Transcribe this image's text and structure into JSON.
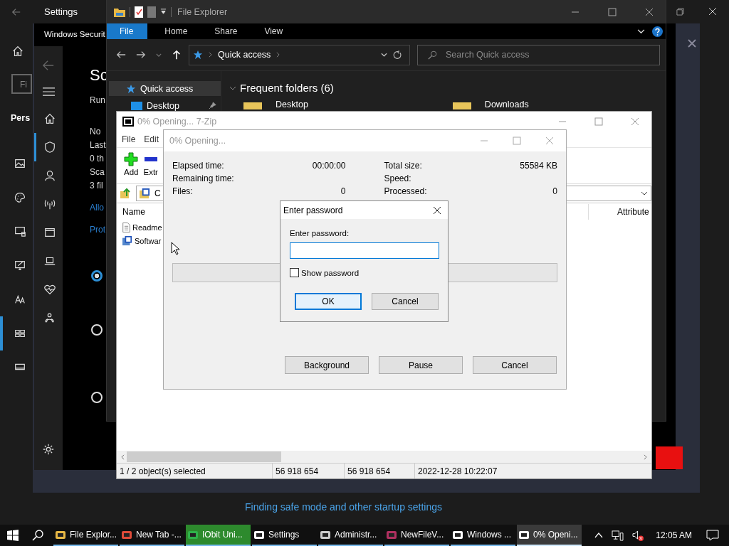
{
  "settings": {
    "title": "Settings",
    "search_placeholder": "Fi",
    "heading": "Pers",
    "nav": [
      {
        "selected": false
      },
      {
        "selected": false
      },
      {
        "selected": false
      },
      {
        "selected": false
      },
      {
        "selected": false
      },
      {
        "selected": true
      },
      {
        "selected": false
      }
    ],
    "link": "Finding safe mode and other startup settings"
  },
  "security": {
    "title": "Windows Securit",
    "heading": "Sc",
    "subtitle": "Run",
    "lines": [
      "No",
      "Last",
      "0 th",
      "Sca",
      "3 fil"
    ],
    "links": [
      "Allo",
      "Prot"
    ],
    "nav": [
      {
        "selected": false
      },
      {
        "selected": true
      },
      {
        "selected": false
      },
      {
        "selected": false
      },
      {
        "selected": false
      },
      {
        "selected": false
      },
      {
        "selected": false
      },
      {
        "selected": false
      }
    ],
    "radios": [
      {
        "selected": true
      },
      {
        "selected": false
      },
      {
        "selected": false
      }
    ]
  },
  "explorer": {
    "title": "File Explorer",
    "ribbon_tabs": [
      {
        "label": "File",
        "selected": true
      },
      {
        "label": "Home",
        "selected": false
      },
      {
        "label": "Share",
        "selected": false
      },
      {
        "label": "View",
        "selected": false
      }
    ],
    "address": "Quick access",
    "search_placeholder": "Search Quick access",
    "nav": [
      {
        "label": "Quick access",
        "selected": true
      },
      {
        "label": "Desktop",
        "selected": false
      }
    ],
    "section": "Frequent folders (6)",
    "folders": [
      "Desktop",
      "Downloads"
    ]
  },
  "sevenzip": {
    "title": "0% Opening... 7-Zip",
    "menu": [
      "File",
      "Edit"
    ],
    "toolbar": [
      "Add",
      "Extr"
    ],
    "path": "C",
    "columns": [
      "Name",
      "Attribute"
    ],
    "rows": [
      "Readme",
      "Softwar"
    ],
    "status": [
      "1 / 2 object(s) selected",
      "56 918 654",
      "56 918 654",
      "2022-12-28 10:22:07"
    ]
  },
  "progress": {
    "title": "0% Opening...",
    "left": [
      {
        "label": "Elapsed time:",
        "value": "00:00:00"
      },
      {
        "label": "Remaining time:"
      },
      {
        "label": "Files:",
        "value": "0"
      }
    ],
    "right": [
      {
        "label": "Total size:",
        "value": "55584 KB"
      },
      {
        "label": "Speed:"
      },
      {
        "label": "Processed:",
        "value": "0"
      }
    ],
    "level": 0,
    "buttons": [
      "Background",
      "Pause",
      "Cancel"
    ]
  },
  "password": {
    "title": "Enter password",
    "label": "Enter password:",
    "show_password": {
      "label": "Show password",
      "checked": false
    },
    "buttons": [
      "OK",
      "Cancel"
    ]
  },
  "taskbar": {
    "apps": [
      {
        "label": "File Explor...",
        "selected": false,
        "flashing": false
      },
      {
        "label": "New Tab -...",
        "selected": false,
        "flashing": false
      },
      {
        "label": "IObit Uni...",
        "selected": false,
        "flashing": true
      },
      {
        "label": "Settings",
        "selected": false,
        "flashing": false
      },
      {
        "label": "Administr...",
        "selected": false,
        "flashing": false
      },
      {
        "label": "NewFileV...",
        "selected": false,
        "flashing": false
      },
      {
        "label": "Windows ...",
        "selected": false,
        "flashing": false
      },
      {
        "label": "0% Openi...",
        "selected": true,
        "flashing": false
      }
    ],
    "time": "12:05 AM"
  }
}
